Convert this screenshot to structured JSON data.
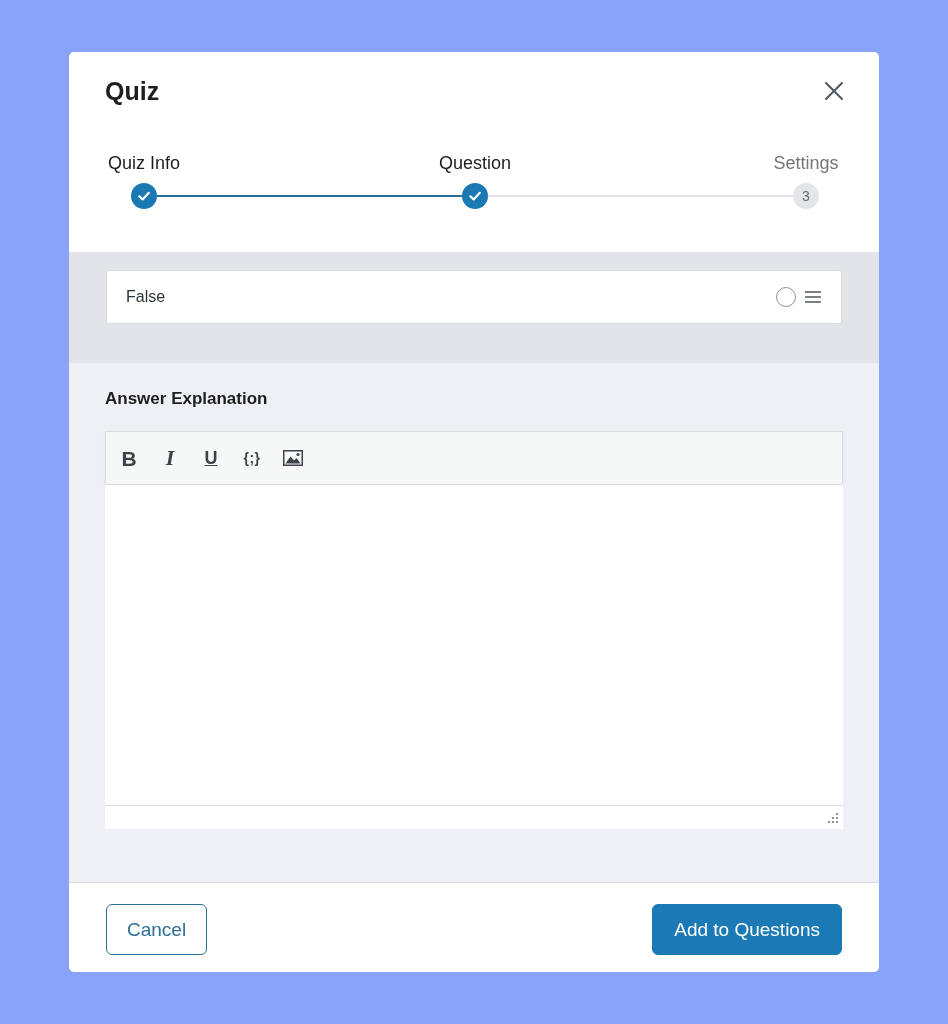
{
  "dialog": {
    "title": "Quiz"
  },
  "steps": [
    {
      "label": "Quiz Info",
      "completed": true
    },
    {
      "label": "Question",
      "completed": true
    },
    {
      "label": "Settings",
      "completed": false,
      "number": "3"
    }
  ],
  "answers": [
    {
      "text": "False",
      "selected": false
    }
  ],
  "explanation": {
    "label": "Answer Explanation",
    "toolbar": [
      {
        "kind": "bold",
        "label": "B"
      },
      {
        "kind": "italic",
        "label": "I"
      },
      {
        "kind": "underline",
        "label": "U"
      },
      {
        "kind": "code",
        "label": "{;}"
      },
      {
        "kind": "image"
      }
    ]
  },
  "buttons": [
    {
      "kind": "secondary",
      "label": "Cancel"
    },
    {
      "kind": "primary",
      "label": "Add to Questions"
    }
  ]
}
